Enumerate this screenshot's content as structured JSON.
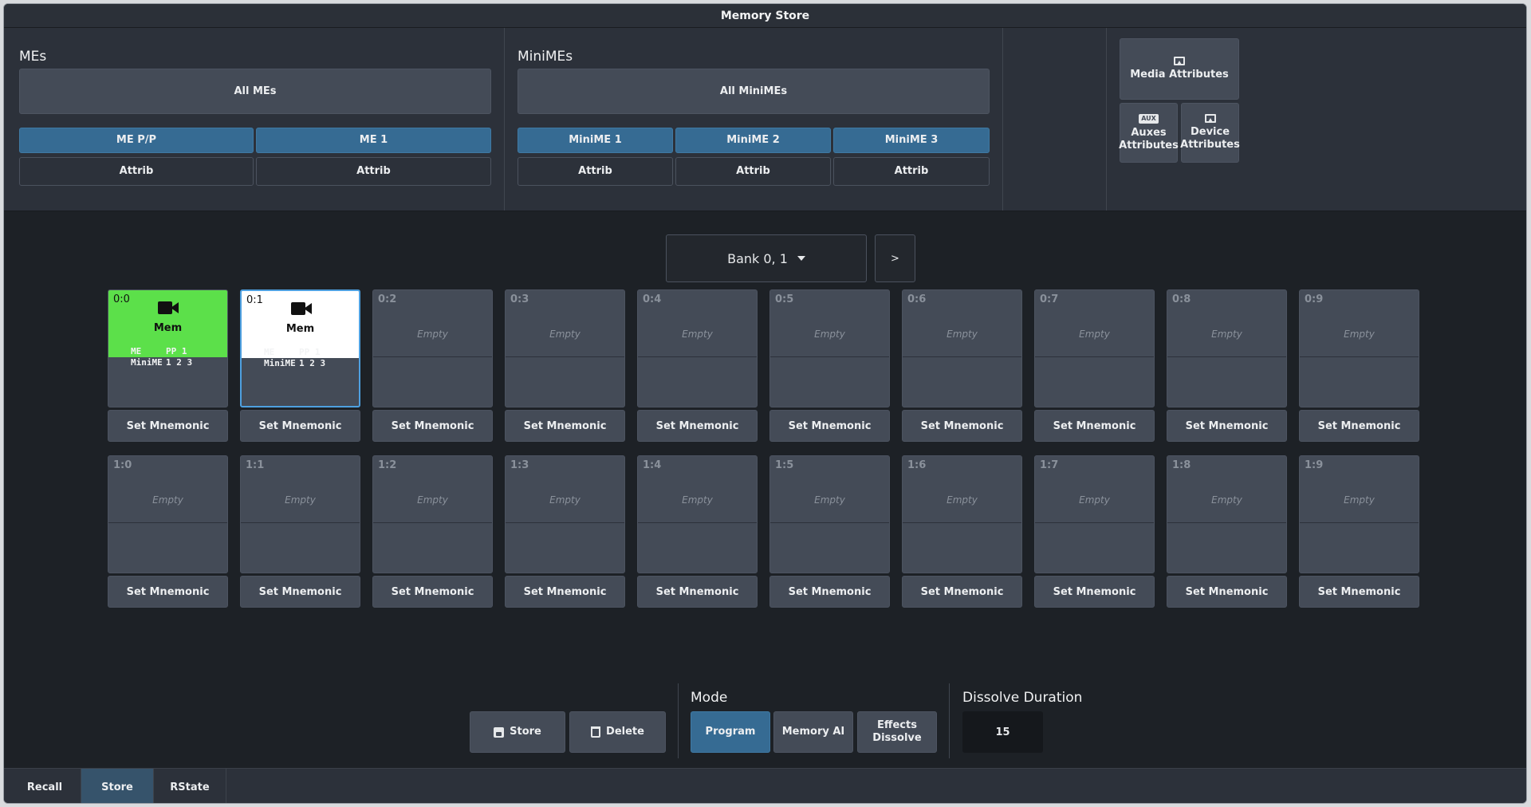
{
  "window": {
    "title": "Memory Store"
  },
  "mes": {
    "title": "MEs",
    "all_label": "All MEs",
    "buttons": [
      "ME P/P",
      "ME 1"
    ],
    "attrib": [
      "Attrib",
      "Attrib"
    ]
  },
  "minimes": {
    "title": "MiniMEs",
    "all_label": "All MiniMEs",
    "buttons": [
      "MiniME 1",
      "MiniME 2",
      "MiniME 3"
    ],
    "attrib": [
      "Attrib",
      "Attrib",
      "Attrib"
    ]
  },
  "attributes": {
    "media": "Media Attributes",
    "auxes": "Auxes Attributes",
    "aux_icon": "AUX",
    "device": "Device Attributes"
  },
  "bank": {
    "label": "Bank 0, 1",
    "next": ">"
  },
  "row0": [
    {
      "idx": "0:0",
      "state": "green",
      "label": "Mem",
      "info": [
        [
          "ME",
          "PP 1"
        ],
        [
          "MiniME",
          "1 2 3"
        ]
      ]
    },
    {
      "idx": "0:1",
      "state": "white",
      "label": "Mem",
      "info": [
        [
          "ME",
          "PP 1"
        ],
        [
          "MiniME",
          "1 2 3"
        ]
      ]
    },
    {
      "idx": "0:2",
      "state": "empty",
      "label": "Empty"
    },
    {
      "idx": "0:3",
      "state": "empty",
      "label": "Empty"
    },
    {
      "idx": "0:4",
      "state": "empty",
      "label": "Empty"
    },
    {
      "idx": "0:5",
      "state": "empty",
      "label": "Empty"
    },
    {
      "idx": "0:6",
      "state": "empty",
      "label": "Empty"
    },
    {
      "idx": "0:7",
      "state": "empty",
      "label": "Empty"
    },
    {
      "idx": "0:8",
      "state": "empty",
      "label": "Empty"
    },
    {
      "idx": "0:9",
      "state": "empty",
      "label": "Empty"
    }
  ],
  "row1": [
    {
      "idx": "1:0",
      "state": "empty",
      "label": "Empty"
    },
    {
      "idx": "1:1",
      "state": "empty",
      "label": "Empty"
    },
    {
      "idx": "1:2",
      "state": "empty",
      "label": "Empty"
    },
    {
      "idx": "1:3",
      "state": "empty",
      "label": "Empty"
    },
    {
      "idx": "1:4",
      "state": "empty",
      "label": "Empty"
    },
    {
      "idx": "1:5",
      "state": "empty",
      "label": "Empty"
    },
    {
      "idx": "1:6",
      "state": "empty",
      "label": "Empty"
    },
    {
      "idx": "1:7",
      "state": "empty",
      "label": "Empty"
    },
    {
      "idx": "1:8",
      "state": "empty",
      "label": "Empty"
    },
    {
      "idx": "1:9",
      "state": "empty",
      "label": "Empty"
    }
  ],
  "mnemonic_label": "Set Mnemonic",
  "actions": {
    "store": "Store",
    "delete": "Delete"
  },
  "mode": {
    "title": "Mode",
    "options": [
      "Program",
      "Memory AI",
      "Effects Dissolve"
    ],
    "selected": "Program"
  },
  "dissolve": {
    "title": "Dissolve Duration",
    "value": "15"
  },
  "tabs": [
    {
      "label": "Recall",
      "active": false
    },
    {
      "label": "Store",
      "active": true
    },
    {
      "label": "RState",
      "active": false
    }
  ],
  "colors": {
    "accent_blue": "#366b93",
    "active_green": "#5ce04a",
    "tile_grey": "#444b57"
  }
}
